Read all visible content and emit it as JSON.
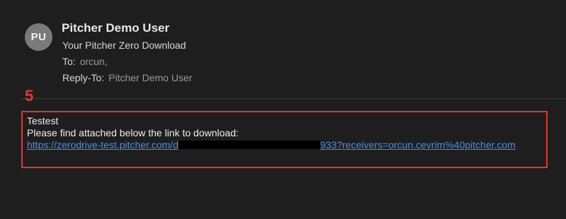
{
  "sender": {
    "initials": "PU",
    "name": "Pitcher Demo User"
  },
  "email": {
    "subject": "Your Pitcher Zero Download",
    "to_label": "To:",
    "to_value": "orcun,",
    "reply_to_label": "Reply-To:",
    "reply_to_value": "Pitcher Demo User"
  },
  "annotation": {
    "step_number": "5",
    "color": "#e8352a"
  },
  "message": {
    "line1": "Testest",
    "line2": "Please find attached below the link to download:",
    "link_prefix": "https://zerodrive-test.pitcher.com/d",
    "link_suffix": "933?receivers=orcun.cevrim%40pitcher.com"
  },
  "colors": {
    "background": "#1e1e1e",
    "link": "#4a90e2"
  }
}
